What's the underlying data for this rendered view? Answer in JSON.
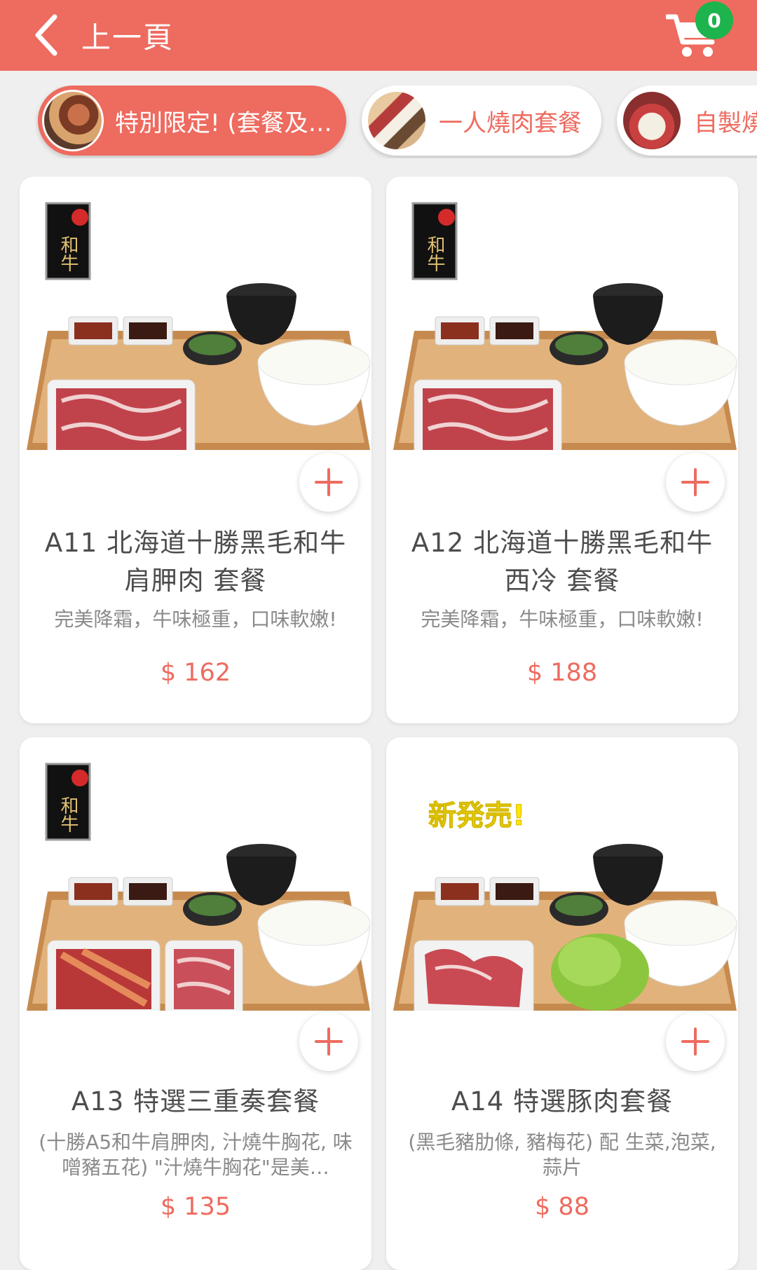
{
  "header": {
    "back_label": "上一頁",
    "cart_count": "0"
  },
  "categories": [
    {
      "label": "特別限定! (套餐及…",
      "active": true
    },
    {
      "label": "一人燒肉套餐",
      "active": false
    },
    {
      "label": "自製燒",
      "active": false
    }
  ],
  "products": [
    {
      "title": "A11 北海道十勝黑毛和牛\n肩胛肉 套餐",
      "description": "完美降霜，牛味極重，口味軟嫩!",
      "price": "$ 162",
      "badge": "和牛"
    },
    {
      "title": "A12 北海道十勝黑毛和牛\n西冷 套餐",
      "description": "完美降霜，牛味極重，口味軟嫩!",
      "price": "$ 188",
      "badge": "和牛"
    },
    {
      "title": "A13 特選三重奏套餐",
      "description": "(十勝A5和牛肩胛肉, 汁燒牛胸花, 味噌豬五花) \"汁燒牛胸花\"是美…",
      "price": "$ 135",
      "badge": "和牛"
    },
    {
      "title": "A14 特選豚肉套餐",
      "description": "(黑毛豬肋條, 豬梅花) 配 生菜,泡菜,蒜片",
      "price": "$ 88",
      "badge": "新発売!"
    }
  ],
  "colors": {
    "brand": "#ee6b5f",
    "cart_badge": "#1db34d",
    "background": "#efefef"
  },
  "icons": [
    "chevron-left-icon",
    "cart-icon",
    "plus-icon"
  ]
}
